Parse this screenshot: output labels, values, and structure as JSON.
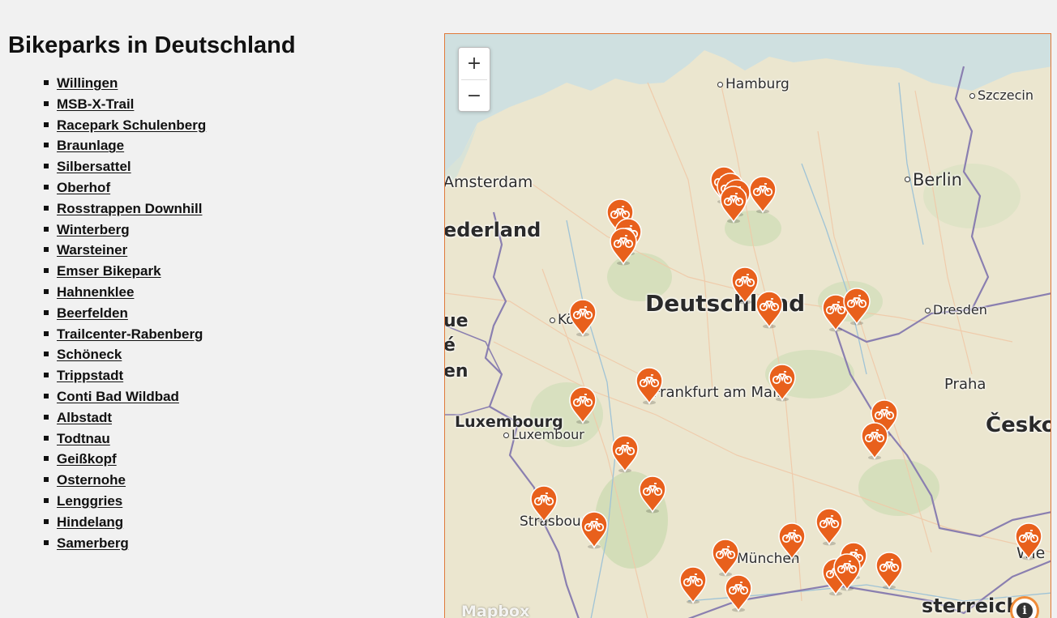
{
  "page": {
    "title": "Bikeparks in Deutschland"
  },
  "bikeparks": [
    "Willingen",
    "MSB-X-Trail",
    "Racepark Schulenberg",
    "Braunlage",
    "Silbersattel",
    "Oberhof",
    "Rosstrappen Downhill",
    "Winterberg",
    "Warsteiner",
    "Emser Bikepark",
    "Hahnenklee",
    "Beerfelden",
    "Trailcenter-Rabenberg",
    "Schöneck",
    "Trippstadt",
    "Conti Bad Wildbad",
    "Albstadt",
    "Todtnau",
    "Geißkopf",
    "Osternohe",
    "Lenggries",
    "Hindelang",
    "Samerberg"
  ],
  "map": {
    "zoom_in_label": "+",
    "zoom_out_label": "−",
    "attribution_logo": "Mapbox",
    "info_label": "i",
    "marker_icon": "bicycle-icon",
    "marker_color": "#e8601c",
    "border_color": "#e07a3a",
    "labels": {
      "hamburg": "Hamburg",
      "szczecin": "Szczecin",
      "amsterdam": "Amsterdam",
      "berlin": "Berlin",
      "nederland": "ederland",
      "deutschland": "Deutschland",
      "koeln": "Köln",
      "dresden": "Dresden",
      "frankfurt": "Frankfurt am Main",
      "praha": "Praha",
      "luxembourg_country": "Luxembourg",
      "luxembourg_city": "Luxembour",
      "cesko": "Česko",
      "strasbourg": "Strasbourg",
      "muenchen": "München",
      "wien": "Wie",
      "oesterreich": "sterreich",
      "belgie_fragment": "ue",
      "belgie_fragment2": "é",
      "belgie_fragment3": "en"
    }
  }
}
